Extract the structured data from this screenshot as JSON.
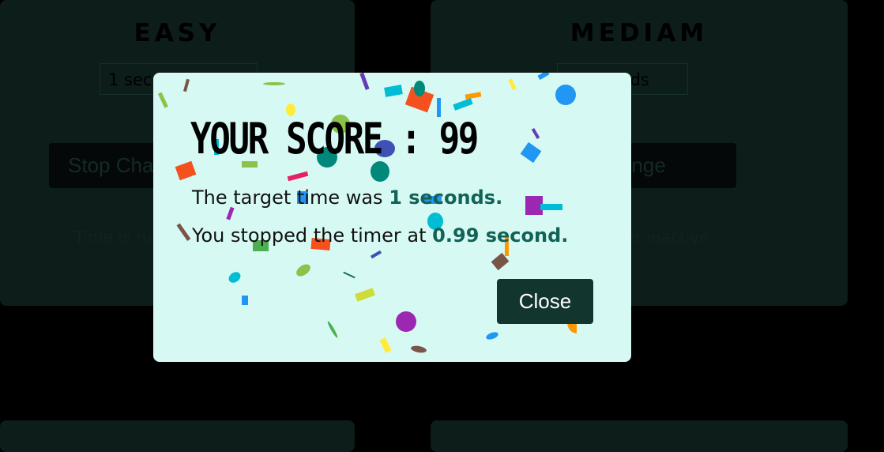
{
  "cards": [
    {
      "title": "EASY",
      "input_value": "1 seconds",
      "button_label": "Stop Challenge",
      "status_text": "Time is running... / Timer inactive"
    },
    {
      "title": "MEDIAM",
      "input_value": "5 seconds",
      "button_label": "Stop Challenge",
      "status_text": "Timer inactive"
    }
  ],
  "modal": {
    "score_text": "YOUR SCORE : 99",
    "target_prefix": "The target time was ",
    "target_value": "1 seconds.",
    "stopped_prefix": "You stopped the timer at ",
    "stopped_value": "0.99 second.",
    "close_label": "Close"
  },
  "colors": {
    "page_bg": "#000000",
    "card_bg": "#0c1d1a",
    "modal_bg": "#d6faf3",
    "accent": "#136258",
    "close_button": "#12352e"
  }
}
